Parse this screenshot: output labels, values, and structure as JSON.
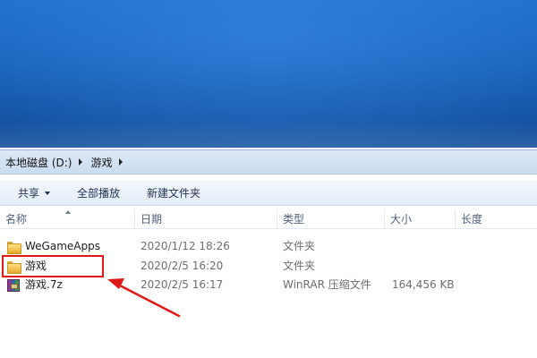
{
  "breadcrumb": {
    "items": [
      "本地磁盘 (D:)",
      "游戏"
    ]
  },
  "commandbar": {
    "share_label": "共享",
    "playall_label": "全部播放",
    "newfolder_label": "新建文件夹"
  },
  "columns": {
    "name": "名称",
    "date": "日期",
    "type": "类型",
    "size": "大小",
    "length": "长度"
  },
  "files": [
    {
      "name": "WeGameApps",
      "date": "2020/1/12 18:26",
      "type": "文件夹",
      "size": "",
      "icon": "folder-icon"
    },
    {
      "name": "游戏",
      "date": "2020/2/5 16:20",
      "type": "文件夹",
      "size": "",
      "icon": "folder-icon"
    },
    {
      "name": "游戏.7z",
      "date": "2020/2/5 16:17",
      "type": "WinRAR 压缩文件",
      "size": "164,456 KB",
      "icon": "winrar-archive-icon"
    }
  ],
  "colors": {
    "annotation": "#e01818",
    "desktop": "#1a66bf"
  }
}
